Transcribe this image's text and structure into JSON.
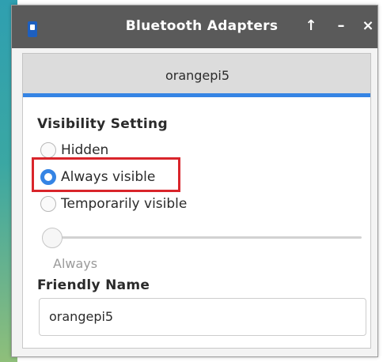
{
  "window": {
    "title": "Bluetooth Adapters",
    "buttons": {
      "keep_above": "↑",
      "minimize": "–",
      "close": "×"
    }
  },
  "tab": {
    "label": "orangepi5"
  },
  "visibility": {
    "heading": "Visibility Setting",
    "options": [
      {
        "label": "Hidden",
        "checked": false
      },
      {
        "label": "Always visible",
        "checked": true
      },
      {
        "label": "Temporarily visible",
        "checked": false
      }
    ],
    "timeout_value": "Always"
  },
  "friendly_name": {
    "heading": "Friendly Name",
    "value": "orangepi5"
  },
  "colors": {
    "accent": "#3584e4",
    "highlight_box": "#d9252b",
    "titlebar": "#5a5a5a"
  }
}
